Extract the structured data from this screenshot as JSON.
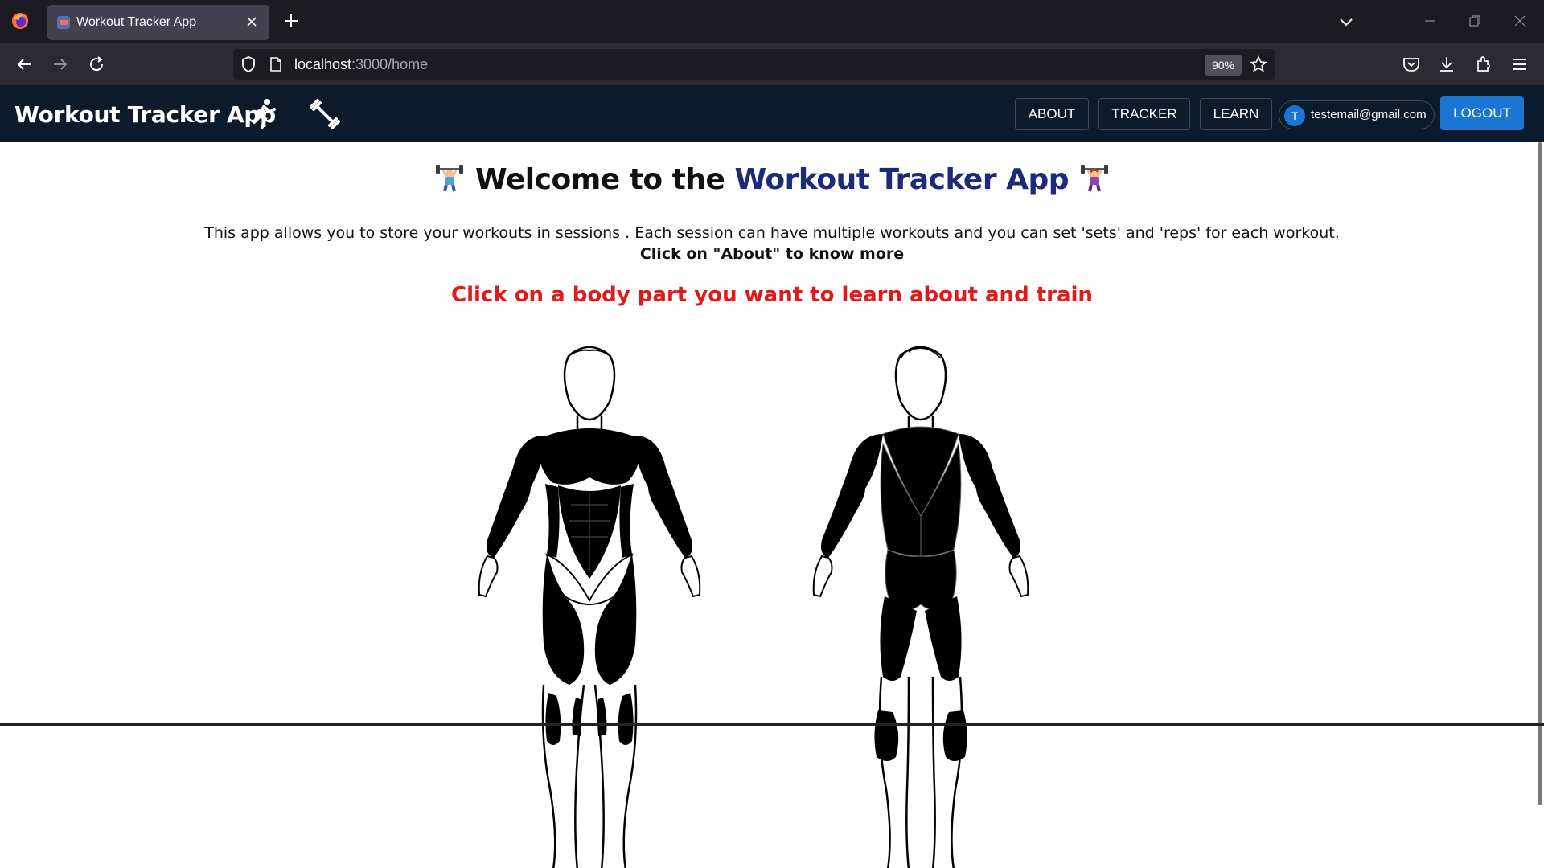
{
  "browser": {
    "tab_title": "Workout Tracker App",
    "url_host": "localhost",
    "url_path": ":3000/home",
    "zoom": "90%"
  },
  "app": {
    "brand": "Workout Tracker App",
    "nav": {
      "about": "ABOUT",
      "tracker": "TRACKER",
      "learn": "LEARN",
      "logout": "LOGOUT"
    },
    "user": {
      "initial": "T",
      "email": "testemail@gmail.com"
    }
  },
  "main": {
    "welcome_prefix": "Welcome to the",
    "welcome_app": "Workout Tracker App",
    "intro": "This app allows you to store your workouts in sessions . Each session can have multiple workouts and you can set 'sets' and 'reps' for each workout.",
    "intro_bold": "Click on \"About\" to know more",
    "prompt": "Click on a body part you want to learn about and train"
  },
  "colors": {
    "app_nav_bg": "#0c1b2c",
    "accent_blue": "#1976d2",
    "title_accent": "#1c2a7a",
    "prompt_red": "#e0191a"
  }
}
